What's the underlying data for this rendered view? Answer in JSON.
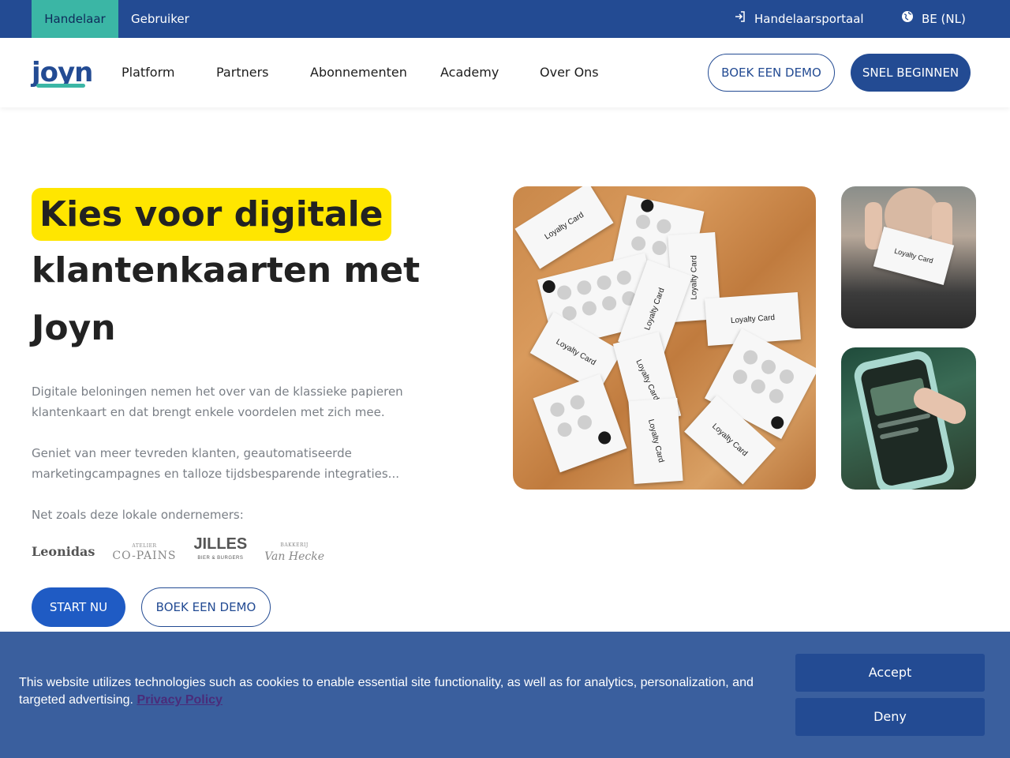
{
  "topbar": {
    "tab_merchant": "Handelaar",
    "tab_user": "Gebruiker",
    "portal_label": "Handelaarsportaal",
    "language_label": "BE (NL)"
  },
  "nav": {
    "logo": "joyn",
    "items": [
      "Platform",
      "Partners",
      "Abonnementen",
      "Academy",
      "Over Ons"
    ],
    "demo_button": "BOEK EEN DEMO",
    "start_button": "SNEL BEGINNEN"
  },
  "hero": {
    "title_highlight": "Kies voor digitale",
    "title_line2": "klantenkaarten met",
    "title_line3": "Joyn",
    "paragraph1": "Digitale beloningen nemen het over van de klassieke papieren klantenkaart en dat brengt enkele voordelen met zich mee.",
    "paragraph2": "Geniet van meer tevreden klanten, geautomatiseerde marketingcampagnes en talloze tijdsbesparende integraties...",
    "paragraph3": "Net zoals deze lokale ondernemers:",
    "partner_logos": {
      "leonidas": "Leonidas",
      "copains_small": "ATELIER",
      "copains": "CO-PAINS",
      "jilles": "JILLES",
      "jilles_small": "BIER & BURGERS",
      "vanhecke_small": "BAKKERIJ",
      "vanhecke": "Van Hecke"
    },
    "start_button": "START NU",
    "demo_button": "BOEK EEN DEMO"
  },
  "images": {
    "card_label": "Loyalty Card"
  },
  "cookie": {
    "text": "This website utilizes technologies such as cookies to enable essential site functionality, as well as for analytics, personalization, and targeted advertising.",
    "link": "Privacy Policy",
    "accept": "Accept",
    "deny": "Deny"
  },
  "colors": {
    "brand_blue": "#234b93",
    "accent_teal": "#3bb6a5",
    "highlight_yellow": "#ffe600",
    "cookie_bg": "#3a5f9e"
  }
}
